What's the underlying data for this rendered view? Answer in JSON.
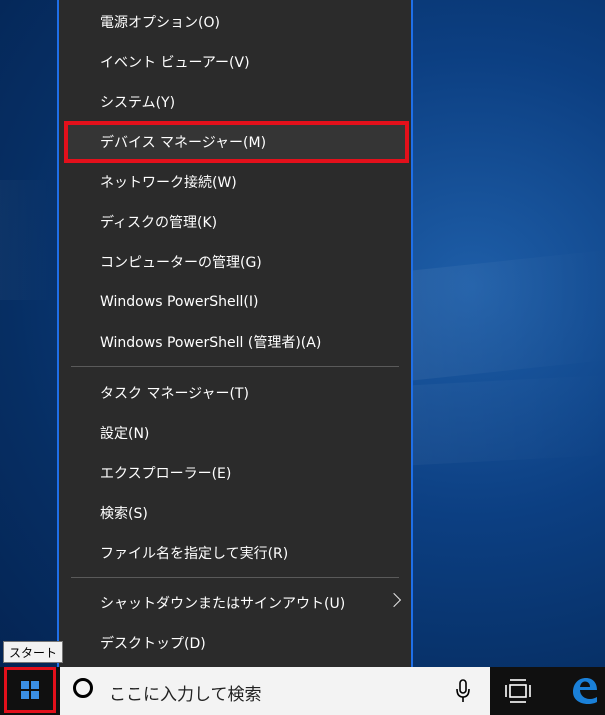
{
  "context_menu": {
    "group1": [
      {
        "label": "電源オプション(O)"
      },
      {
        "label": "イベント ビューアー(V)"
      },
      {
        "label": "システム(Y)"
      },
      {
        "label": "デバイス マネージャー(M)"
      },
      {
        "label": "ネットワーク接続(W)"
      },
      {
        "label": "ディスクの管理(K)"
      },
      {
        "label": "コンピューターの管理(G)"
      },
      {
        "label": "Windows PowerShell(I)"
      },
      {
        "label": "Windows PowerShell (管理者)(A)"
      }
    ],
    "group2": [
      {
        "label": "タスク マネージャー(T)"
      },
      {
        "label": "設定(N)"
      },
      {
        "label": "エクスプローラー(E)"
      },
      {
        "label": "検索(S)"
      },
      {
        "label": "ファイル名を指定して実行(R)"
      }
    ],
    "group3": [
      {
        "label": "シャットダウンまたはサインアウト(U)"
      },
      {
        "label": "デスクトップ(D)"
      }
    ],
    "highlighted_item": "デバイス マネージャー(M)"
  },
  "tooltip": {
    "text": "スタート"
  },
  "taskbar": {
    "search_placeholder": "ここに入力して検索",
    "icons": [
      "windows-logo-icon",
      "cortana-icon",
      "microphone-icon",
      "task-view-icon",
      "edge-icon"
    ]
  },
  "colors": {
    "menu_background": "#2b2b2b",
    "menu_border": "#1f6fe8",
    "highlight_outline": "#e3101b",
    "taskbar": "#101010",
    "windows_blue": "#3a8fe6",
    "edge_blue": "#1a80d8"
  }
}
